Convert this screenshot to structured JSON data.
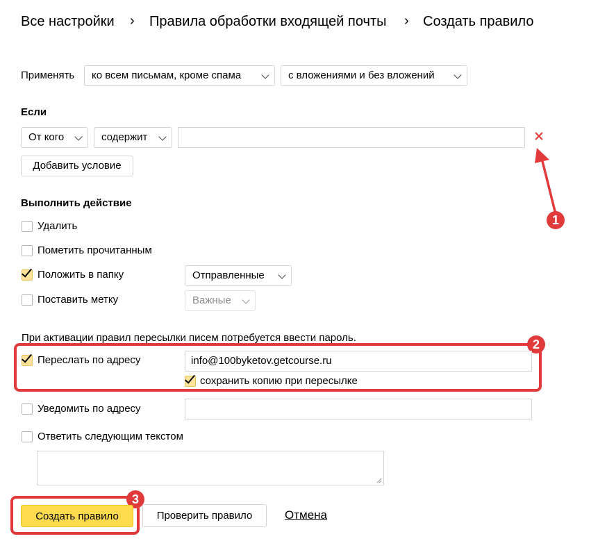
{
  "breadcrumb": {
    "items": [
      "Все настройки",
      "Правила обработки входящей почты",
      "Создать правило"
    ],
    "separator": "›"
  },
  "apply": {
    "label": "Применять",
    "scope_select": "ко всем письмам, кроме спама",
    "attach_select": "с вложениями и без вложений"
  },
  "conditions": {
    "heading": "Если",
    "field_select": "От кого",
    "op_select": "содержит",
    "value": "",
    "remove_icon": "close-icon",
    "add_button": "Добавить условие"
  },
  "actions": {
    "heading": "Выполнить действие",
    "delete": {
      "label": "Удалить",
      "checked": false
    },
    "mark_read": {
      "label": "Пометить прочитанным",
      "checked": false
    },
    "move_folder": {
      "label": "Положить в папку",
      "checked": true,
      "folder": "Отправленные"
    },
    "set_label": {
      "label": "Поставить метку",
      "checked": false,
      "label_value": "Важные"
    }
  },
  "forward": {
    "notice": "При активации правил пересылки писем потребуется ввести пароль.",
    "forward_to": {
      "label": "Переслать по адресу",
      "checked": true,
      "address": "info@100byketov.getcourse.ru"
    },
    "keep_copy": {
      "label": "сохранить копию при пересылке",
      "checked": true
    },
    "notify": {
      "label": "Уведомить по адресу",
      "checked": false,
      "address": ""
    },
    "reply": {
      "label": "Ответить следующим текстом",
      "checked": false,
      "text": ""
    }
  },
  "buttons": {
    "create": "Создать правило",
    "check": "Проверить правило",
    "cancel": "Отмена"
  },
  "annotations": {
    "badge1": "1",
    "badge2": "2",
    "badge3": "3"
  },
  "colors": {
    "accent_yellow": "#ffdb4d",
    "annotation_red": "#e03a3a",
    "check_yellow": "#ffe39a"
  }
}
